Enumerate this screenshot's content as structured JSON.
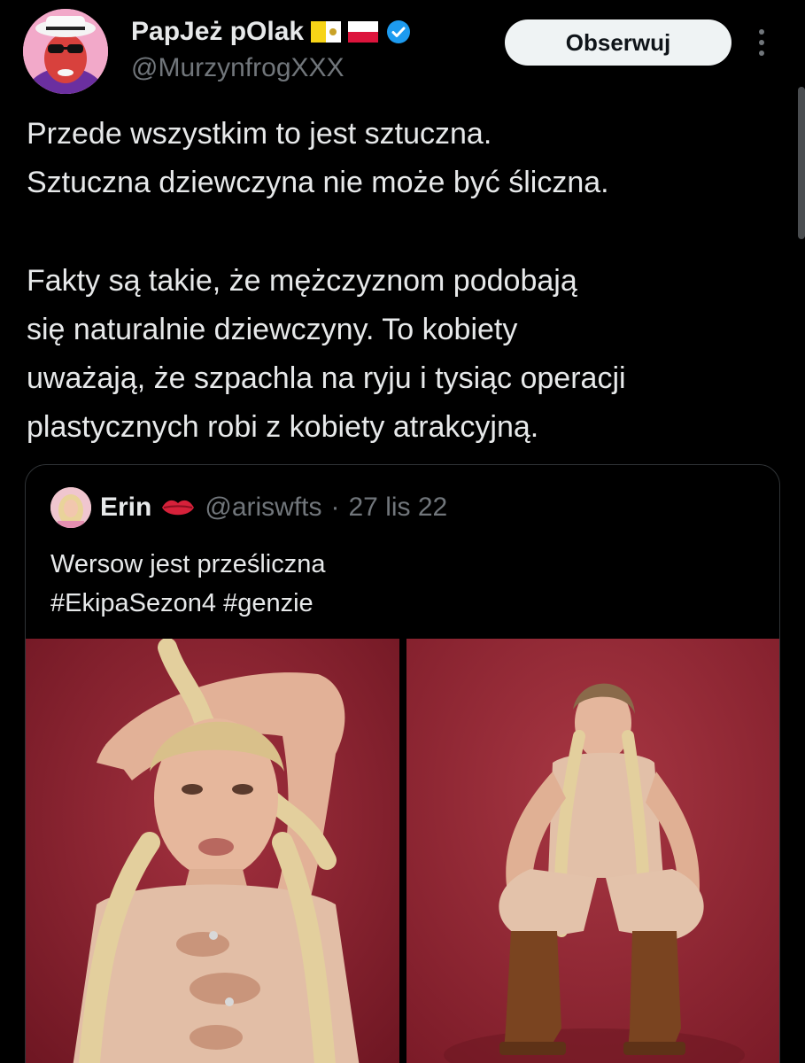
{
  "author": {
    "display_name": "PapJeż pOlak",
    "handle": "@MurzynfrogXXX",
    "avatar_icon": "avatar-man-sunglasses-icon",
    "flags": [
      "vatican-flag-icon",
      "poland-flag-icon"
    ],
    "verified_icon": "verified-badge-icon",
    "verified_color": "#1d9bf0"
  },
  "actions": {
    "follow_label": "Obserwuj",
    "more_icon": "more-vertical-icon"
  },
  "tweet": {
    "lines_p1": [
      "Przede wszystkim to jest sztuczna.",
      "Sztuczna dziewczyna nie może być śliczna."
    ],
    "lines_p2": [
      "Fakty są takie, że mężczyznom podobają",
      "się naturalnie dziewczyny. To kobiety",
      "uważają, że szpachla na ryju i tysiąc operacji",
      "plastycznych robi z kobiety atrakcyjną."
    ]
  },
  "quoted": {
    "name": "Erin",
    "emoji_icon": "lips-icon",
    "handle": "@ariswfts",
    "separator": "·",
    "time": "27 lis 22",
    "text_lines": [
      "Wersow jest prześliczna",
      "#EkipaSezon4 #genzie"
    ],
    "media": [
      {
        "icon": "photo-woman-braids-closeup"
      },
      {
        "icon": "photo-woman-braids-crouching"
      }
    ]
  },
  "colors": {
    "background": "#000000",
    "text": "#e7e9ea",
    "muted": "#71767b",
    "border": "#2f3336",
    "button_bg": "#eff3f4",
    "photo_bg": "#8a2430"
  }
}
